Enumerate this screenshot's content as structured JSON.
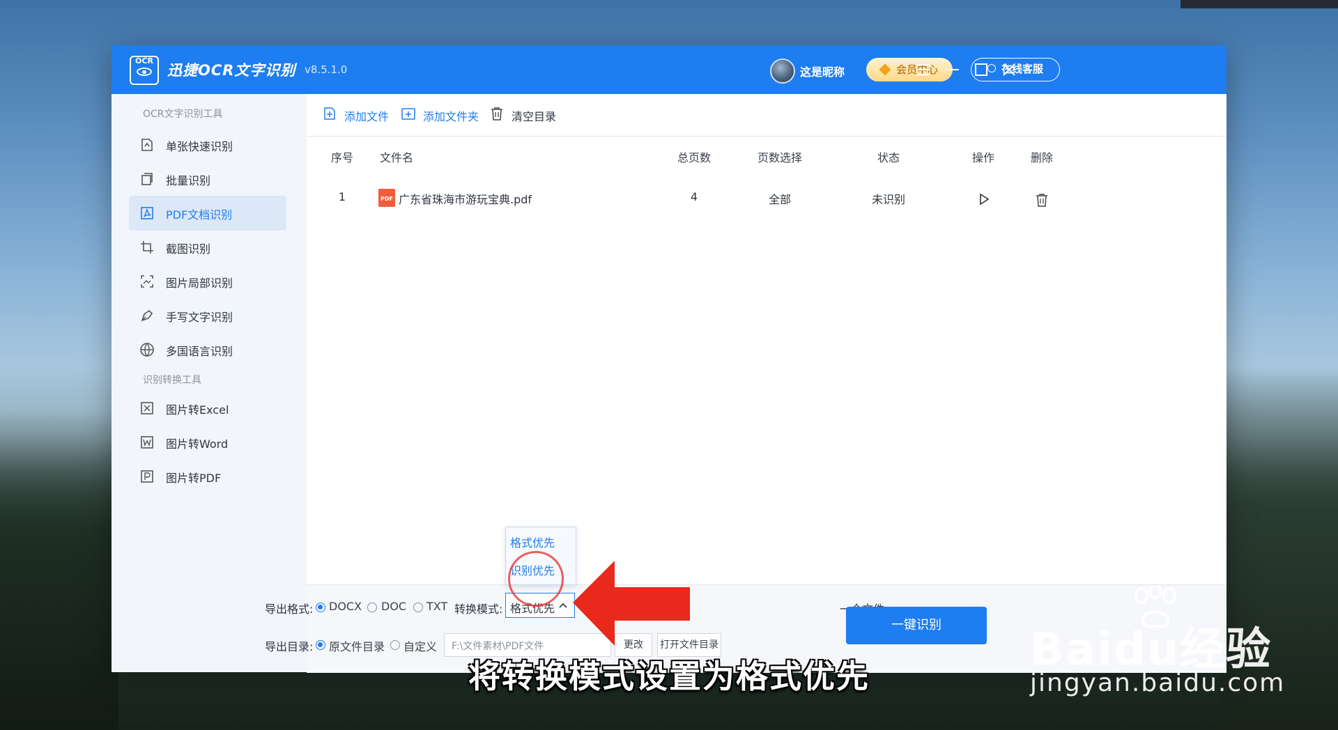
{
  "app": {
    "title": "迅捷OCR文字识别",
    "version": "v8.5.1.0",
    "logo_text": "OCR",
    "user_nickname": "这是昵称",
    "vip_label": "会员中心",
    "service_label": "在线客服"
  },
  "sidebar": {
    "section1": "OCR文字识别工具",
    "items": [
      {
        "label": "单张快速识别",
        "icon": "single-doc-icon"
      },
      {
        "label": "批量识别",
        "icon": "batch-icon"
      },
      {
        "label": "PDF文档识别",
        "icon": "pdf-icon"
      },
      {
        "label": "截图识别",
        "icon": "crop-icon"
      },
      {
        "label": "图片局部识别",
        "icon": "image-region-icon"
      },
      {
        "label": "手写文字识别",
        "icon": "pen-icon"
      },
      {
        "label": "多国语言识别",
        "icon": "globe-icon"
      }
    ],
    "section2": "识别转换工具",
    "tools": [
      {
        "label": "图片转Excel",
        "icon": "excel-icon"
      },
      {
        "label": "图片转Word",
        "icon": "word-icon"
      },
      {
        "label": "图片转PDF",
        "icon": "pdf-file-icon"
      }
    ],
    "active_index": 2
  },
  "toolbar": {
    "add_file": "添加文件",
    "add_folder": "添加文件夹",
    "clear": "清空目录"
  },
  "table": {
    "headers": [
      "序号",
      "文件名",
      "总页数",
      "页数选择",
      "状态",
      "操作",
      "删除"
    ],
    "rows": [
      {
        "index": "1",
        "filename": "广东省珠海市游玩宝典.pdf",
        "pages": "4",
        "page_select": "全部",
        "status": "未识别"
      }
    ]
  },
  "bottom": {
    "export_format_label": "导出格式:",
    "formats": [
      "DOCX",
      "DOC",
      "TXT"
    ],
    "selected_format": "DOCX",
    "convert_mode_label": "转换模式:",
    "convert_mode_value": "格式优先",
    "convert_mode_options": [
      "格式优先",
      "识别优先"
    ],
    "merge_partial": "一个文件",
    "export_dir_label": "导出目录:",
    "dir_options": [
      "原文件目录",
      "自定义"
    ],
    "dir_path": "F:\\文件素材\\PDF文件",
    "change_btn": "更改",
    "open_dir_btn": "打开文件目录",
    "start_btn": "一键识别"
  },
  "overlay": {
    "caption": "将转换模式设置为格式优先",
    "watermark": "Baidu经验",
    "watermark_url": "jingyan.baidu.com",
    "arrow_color": "#e8291c"
  },
  "colors": {
    "primary": "#1e7df0",
    "sidebar_bg": "#f2f6fb",
    "active_bg": "#dce8f8"
  }
}
